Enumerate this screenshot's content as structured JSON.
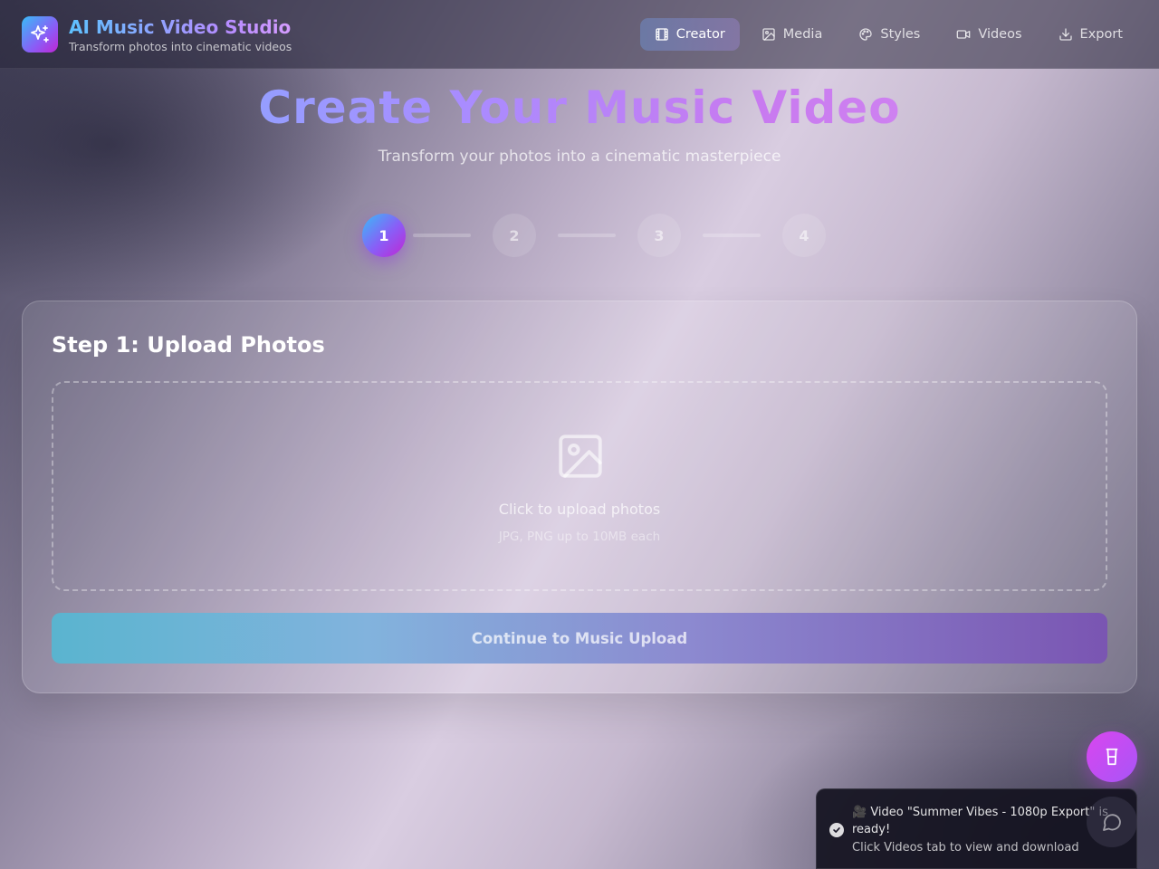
{
  "brand": {
    "title": "AI Music Video Studio",
    "subtitle": "Transform photos into cinematic videos",
    "logo_icon": "sparkles-icon"
  },
  "nav": {
    "items": [
      {
        "label": "Creator",
        "icon": "film-icon",
        "active": true
      },
      {
        "label": "Media",
        "icon": "image-icon",
        "active": false
      },
      {
        "label": "Styles",
        "icon": "palette-icon",
        "active": false
      },
      {
        "label": "Videos",
        "icon": "video-camera-icon",
        "active": false
      },
      {
        "label": "Export",
        "icon": "download-icon",
        "active": false
      }
    ]
  },
  "hero": {
    "title": "Create Your Music Video",
    "subtitle": "Transform your photos into a cinematic masterpiece"
  },
  "steps": {
    "current": 1,
    "items": [
      "1",
      "2",
      "3",
      "4"
    ]
  },
  "card": {
    "title": "Step 1: Upload Photos",
    "dropzone": {
      "title": "Click to upload photos",
      "hint": "JPG, PNG up to 10MB each",
      "icon": "image-icon"
    },
    "continue_label": "Continue to Music Upload"
  },
  "toast": {
    "title": "🎥 Video \"Summer Vibes - 1080p Export\" is ready!",
    "description": "Click Videos tab to view and download",
    "icon": "check-circle-icon"
  },
  "fab": {
    "icon": "cup-icon"
  },
  "chat": {
    "icon": "chat-bubble-icon"
  },
  "colors": {
    "accent_start": "#38bdf8",
    "accent_mid": "#8b5cf6",
    "accent_end": "#c026d3",
    "toast_bg": "#14121f"
  }
}
